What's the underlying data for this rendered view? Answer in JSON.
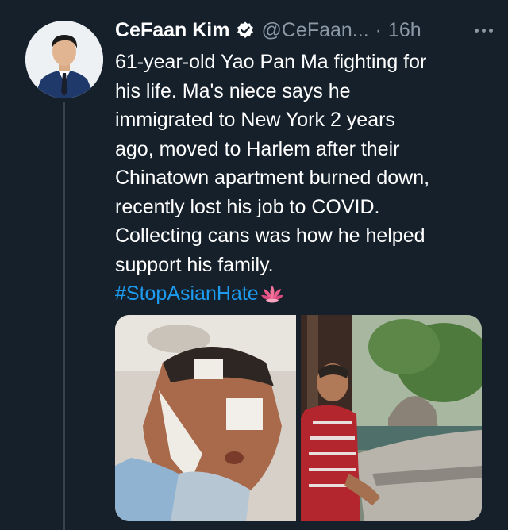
{
  "tweet": {
    "author_name": "CeFaan Kim",
    "handle": "@CeFaan...",
    "separator": "·",
    "time": "16h",
    "lines": [
      "61-year-old Yao Pan Ma fighting for",
      "his life. Ma's niece says he",
      "immigrated to New York 2 years",
      "ago, moved to Harlem after their",
      "Chinatown apartment burned down,",
      "recently lost his job to COVID.",
      "Collecting cans was how he helped",
      "support his family."
    ],
    "hashtag": "#StopAsianHate",
    "icons": {
      "verified": "verified-badge-icon",
      "more": "more-options-icon",
      "emoji": "lotus-emoji-icon"
    },
    "colors": {
      "background": "#15202b",
      "hashtag": "#1d9bf0",
      "secondary_text": "#8b98a5"
    }
  }
}
